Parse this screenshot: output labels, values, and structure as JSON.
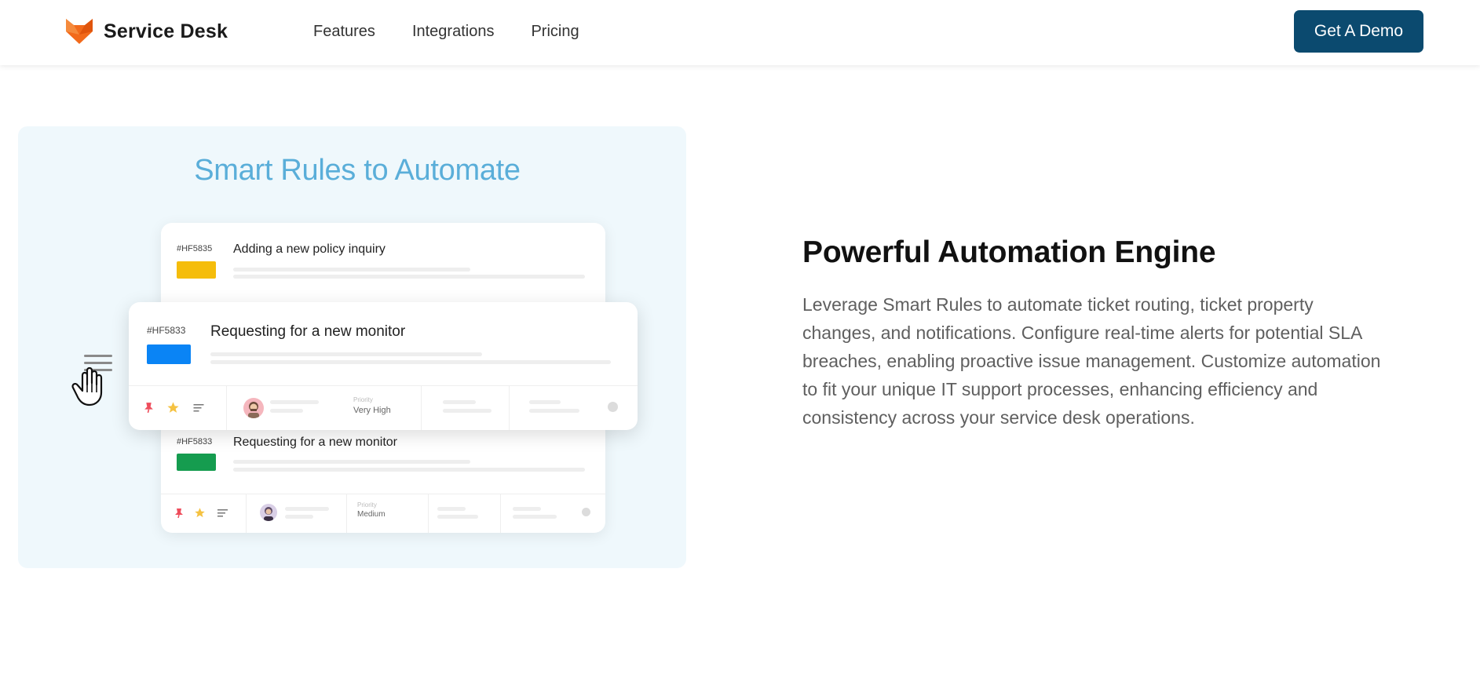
{
  "nav": {
    "brand": "Service Desk",
    "links": [
      "Features",
      "Integrations",
      "Pricing"
    ],
    "cta": "Get A Demo"
  },
  "illustration": {
    "title": "Smart Rules to Automate",
    "tickets": [
      {
        "id": "#HF5835",
        "title": "Adding a new policy inquiry",
        "color": "#f5bd0b"
      },
      {
        "id": "#HF5833",
        "title": "Requesting for a new monitor",
        "color": "#0a84f5",
        "priority_label": "Priority",
        "priority": "Very High"
      },
      {
        "id": "#HF5833",
        "title": "Requesting for a new monitor",
        "color": "#159c4f",
        "priority_label": "Priority",
        "priority": "Medium"
      }
    ]
  },
  "feature": {
    "heading": "Powerful Automation Engine",
    "description": "Leverage Smart Rules to automate ticket routing, ticket property changes, and notifications. Configure real-time alerts for potential SLA breaches, enabling proactive issue management. Customize automation to fit your unique IT support processes, enhancing efficiency and consistency across your service desk operations."
  },
  "colors": {
    "brand_orange": "#f26a1b",
    "cta_bg": "#0b4a6f",
    "panel_bg": "#eff8fc",
    "panel_title": "#5aaed9"
  }
}
